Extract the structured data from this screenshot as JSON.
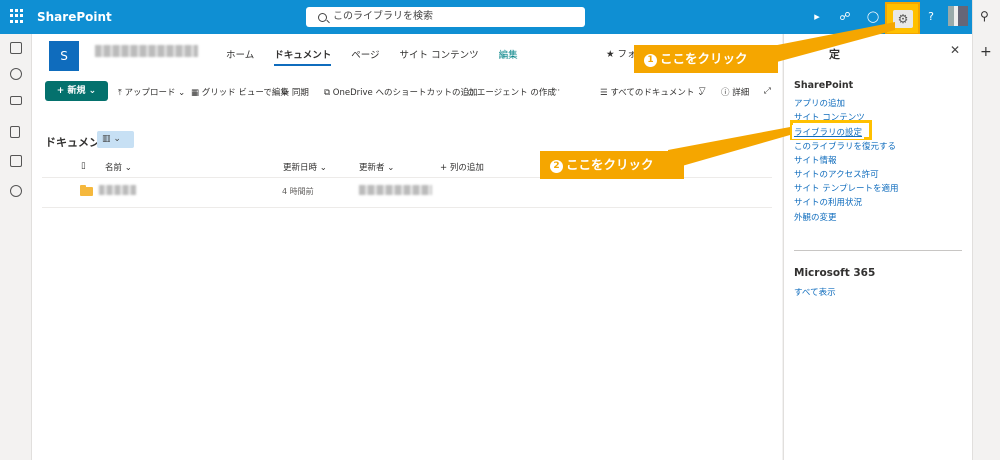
{
  "suitebar": {
    "app_name": "SharePoint",
    "search_placeholder": "このライブラリを検索",
    "help_label": "?"
  },
  "site": {
    "logo_letter": "S",
    "nav": [
      "ホーム",
      "ドキュメント",
      "ページ",
      "サイト コンテンツ",
      "編集"
    ],
    "follow_label": "フォ"
  },
  "commandbar": {
    "new_label": "新規",
    "upload_label": "アップロード",
    "grid_label": "グリッド ビューで編集",
    "sync_label": "同期",
    "shortcut_label": "OneDrive へのショートカットの追加",
    "agent_label": "エージェント の作成",
    "more_label": "···",
    "view_label": "すべてのドキュメント",
    "details_label": "詳細"
  },
  "library": {
    "title": "ドキュメント",
    "columns": {
      "name": "名前",
      "modified": "更新日時",
      "modified_by": "更新者",
      "add_column": "列の追加"
    },
    "rows": [
      {
        "modified": "4 時間前"
      }
    ]
  },
  "settings_panel": {
    "title_partial": "定",
    "sharepoint_section": "SharePoint",
    "links": [
      "アプリの追加",
      "サイト コンテンツ",
      "ライブラリの設定",
      "このライブラリを復元する",
      "サイト情報",
      "サイトのアクセス許可",
      "サイト テンプレートを適用",
      "サイトの利用状況",
      "外観の変更"
    ],
    "m365_section": "Microsoft 365",
    "m365_link": "すべて表示"
  },
  "callouts": {
    "one_num": "1",
    "one_text": "ここをクリック",
    "two_num": "2",
    "two_text": "ここをクリック"
  },
  "colors": {
    "suitebar": "#0f8fd3",
    "accent_teal": "#04716d",
    "callout": "#f5a600",
    "highlight": "#ffc000",
    "link": "#0f6cbd"
  }
}
